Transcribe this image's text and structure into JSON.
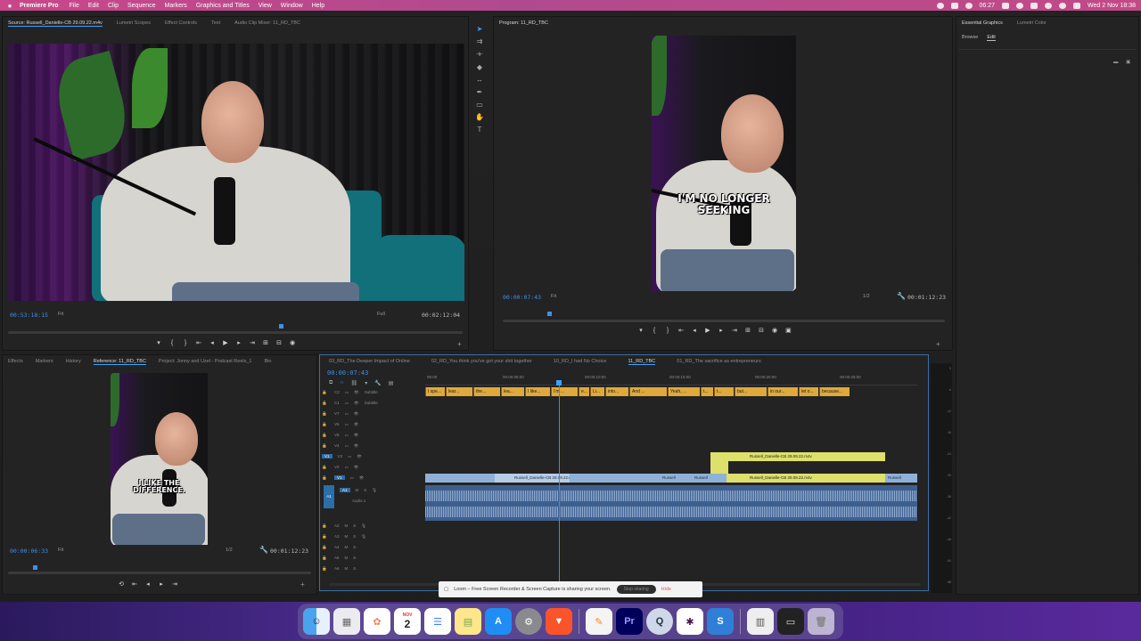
{
  "menubar": {
    "app": "Premiere Pro",
    "items": [
      "File",
      "Edit",
      "Clip",
      "Sequence",
      "Markers",
      "Graphics and Titles",
      "View",
      "Window",
      "Help"
    ],
    "time": "06:27",
    "date": "Wed 2 Nov  18:38"
  },
  "source_panel": {
    "tabs": [
      "Source: Russell_Danielle-CB 29.09.22.m4v",
      "Lumetri Scopes",
      "Effect Controls",
      "Text",
      "Audio Clip Mixer: 11_RD_TBC"
    ],
    "timecode": "00:53:18:15",
    "fit": "Fit",
    "quality": "Full",
    "duration": "00:02:12:04"
  },
  "program_panel": {
    "tab": "Program: 11_RD_TBC",
    "caption": "I'M NO LONGER SEEKING",
    "timecode": "00:00:07:43",
    "fit": "Fit",
    "ratio": "1/2",
    "duration": "00:01:12:23"
  },
  "right_panel": {
    "tabs": [
      "Essential Graphics",
      "Lumetri Color"
    ],
    "subtabs": [
      "Browse",
      "Edit"
    ]
  },
  "reference_panel": {
    "tabs": [
      "Effects",
      "Markers",
      "History",
      "Reference: 11_RD_TBC",
      "Project: Jonny and Uzel - Podcast Reels_1",
      "Bin"
    ],
    "caption": "I LIKE THE DIFFERENCE.",
    "timecode": "00:00:06:33",
    "fit": "Fit",
    "ratio": "1/2",
    "duration": "00:01:12:23"
  },
  "timeline": {
    "tabs": [
      "03_RD_The Deeper Impact of Online",
      "02_RD_You think you've got your shit together",
      "10_RD_I had No Choice",
      "11_RD_TBC",
      "01_RD_The sacrifice as entrepreneurs"
    ],
    "timecode": "00:00:07:43",
    "ruler": [
      "00:00",
      "00:00:05:00",
      "00:00:10:00",
      "00:00:15:00",
      "00:00:20:00",
      "00:00:25:00"
    ],
    "tracks_video": [
      "C2",
      "C1",
      "V7",
      "V6",
      "V5",
      "V4",
      "V3",
      "V2",
      "V1"
    ],
    "tracks_audio": [
      "A1",
      "A2",
      "A3",
      "A4",
      "A5",
      "A6"
    ],
    "track_names": {
      "c2": "Subtitle",
      "c1": "Subtitle",
      "a1": "Audio 1"
    },
    "subtitles": [
      "I spe...",
      "lear...",
      "the...",
      "lea...",
      "I like...",
      "I'm ...",
      "e...",
      "Li...",
      "into...",
      "And ...",
      "Yeah, ...",
      "t...",
      "t...",
      "but...",
      "in our...",
      "let o...",
      "because..."
    ],
    "v2_clip": "Russell_Danielle-CB 29.09.22.m4v",
    "v1_clips": [
      "Russell_Danielle-CB 29.09.22.m4v",
      "Russell",
      "Russell",
      "Russell_Danielle-CB 29.09.22.m4v",
      "Russell"
    ]
  },
  "meter_labels": [
    "0",
    "-6",
    "-12",
    "-18",
    "-24",
    "-30",
    "-36",
    "-42",
    "-48",
    "-54",
    "dB"
  ],
  "loom": {
    "message": "Loom – Free Screen Recorder & Screen Capture is sharing your screen.",
    "stop": "Stop sharing",
    "hide": "Hide"
  },
  "dock": {
    "calendar_day": "2",
    "calendar_month": "NOV",
    "icons": [
      "finder-icon",
      "launchpad-icon",
      "photos-icon",
      "calendar-icon",
      "reminders-icon",
      "notes-icon",
      "app-store-icon",
      "system-settings-icon",
      "brave-browser-icon",
      "pages-icon",
      "premiere-pro-icon",
      "quicktime-icon",
      "slack-icon",
      "scrivener-icon",
      "preview-icon",
      "finder-window-icon",
      "trash-icon"
    ],
    "premiere_label": "Pr",
    "scrivener_label": "S"
  }
}
